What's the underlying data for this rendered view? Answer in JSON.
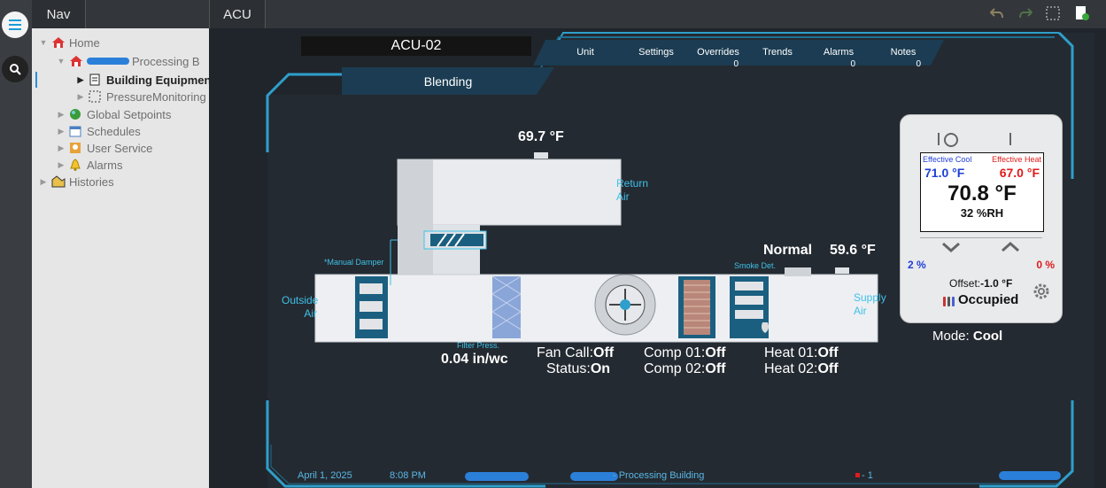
{
  "nav": {
    "tab": "Nav",
    "tree": [
      {
        "label": "Home",
        "icon": "home-icon",
        "expanded": true
      },
      {
        "label": "Processing B",
        "icon": "home-icon",
        "expanded": true
      },
      {
        "label": "Building Equipmen",
        "icon": "document-icon",
        "selected": true
      },
      {
        "label": "PressureMonitoring",
        "icon": "dotted-frame-icon"
      },
      {
        "label": "Global Setpoints",
        "icon": "globe-icon"
      },
      {
        "label": "Schedules",
        "icon": "calendar-icon"
      },
      {
        "label": "User Service",
        "icon": "user-icon"
      },
      {
        "label": "Alarms",
        "icon": "bell-icon"
      },
      {
        "label": "Histories",
        "icon": "histories-icon"
      }
    ]
  },
  "main": {
    "tab": "ACU",
    "unit_name": "ACU-02",
    "mode_tab": "Blending",
    "menu": [
      {
        "label": "Unit",
        "count": ""
      },
      {
        "label": "Settings",
        "count": ""
      },
      {
        "label": "Overrides",
        "count": "0"
      },
      {
        "label": "Trends",
        "count": ""
      },
      {
        "label": "Alarms",
        "count": "0"
      },
      {
        "label": "Notes",
        "count": "0"
      }
    ],
    "return_temp": "69.7 °F",
    "return_air_label": "Return\nAir",
    "outside_air_label": "Outside\nAir",
    "supply_air_label": "Supply\nAir",
    "manual_damper": "*Manual Damper",
    "smoke_det_label": "Smoke Det.",
    "smoke_status": "Normal",
    "supply_temp": "59.6 °F",
    "filter_label": "Filter Press.",
    "filter_value": "0.04 in/wc",
    "fan_call_label": "Fan Call:",
    "fan_call_value": "Off",
    "status_label": "Status:",
    "status_value": "On",
    "comp1_label": "Comp 01:",
    "comp1_value": "Off",
    "comp2_label": "Comp 02:",
    "comp2_value": "Off",
    "heat1_label": "Heat 01:",
    "heat1_value": "Off",
    "heat2_label": "Heat 02:",
    "heat2_value": "Off"
  },
  "thermostat": {
    "eff_cool_label": "Effective Cool",
    "eff_cool_value": "71.0 °F",
    "eff_heat_label": "Effective Heat",
    "eff_heat_value": "67.0 °F",
    "space_temp": "70.8 °F",
    "humidity": "32 %RH",
    "cool_pct": "2 %",
    "heat_pct": "0 %",
    "offset_label": "Offset:",
    "offset_value": "-1.0 °F",
    "occupancy": "Occupied",
    "mode_label": "Mode:",
    "mode_value": "Cool"
  },
  "footer": {
    "date": "April 1, 2025",
    "time": "8:08 PM",
    "location": "- Processing Building",
    "alarm": "- 1"
  },
  "colors": {
    "accent": "#3fc1e8",
    "cool": "#1f3fd6",
    "heat": "#e01b1b"
  }
}
